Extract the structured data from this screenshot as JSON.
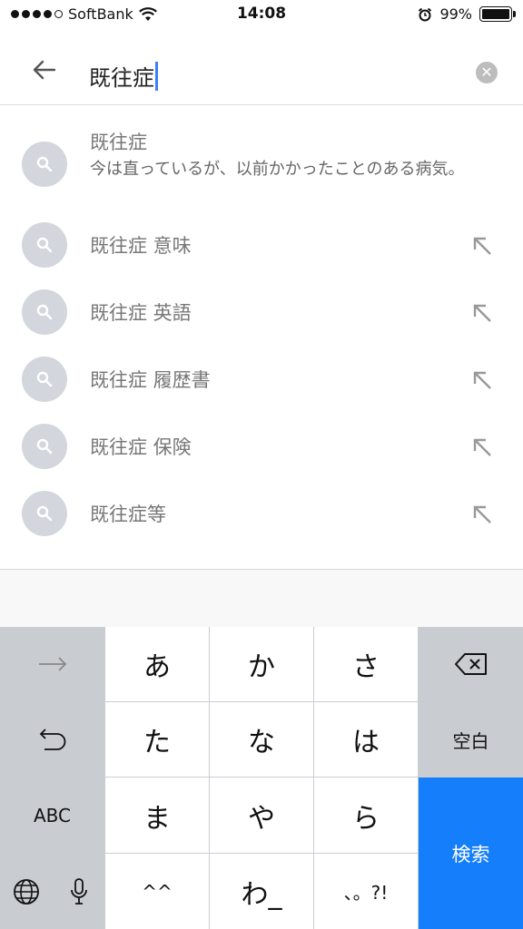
{
  "status_bar": {
    "carrier": "SoftBank",
    "time": "14:08",
    "battery": "99%"
  },
  "search": {
    "query": "既往症"
  },
  "suggestions": [
    {
      "text": "既往症",
      "description": "今は直っているが、以前かかったことのある病気。"
    },
    {
      "text": "既往症 意味"
    },
    {
      "text": "既往症 英語"
    },
    {
      "text": "既往症 履歴書"
    },
    {
      "text": "既往症 保険"
    },
    {
      "text": "既往症等"
    }
  ],
  "keyboard": {
    "row1": [
      "あ",
      "か",
      "さ"
    ],
    "row2": [
      "た",
      "な",
      "は"
    ],
    "row3": [
      "ま",
      "や",
      "ら"
    ],
    "row4": [
      "^^",
      "わ_",
      "、。?!"
    ],
    "space_label": "空白",
    "abc_label": "ABC",
    "search_label": "検索"
  }
}
